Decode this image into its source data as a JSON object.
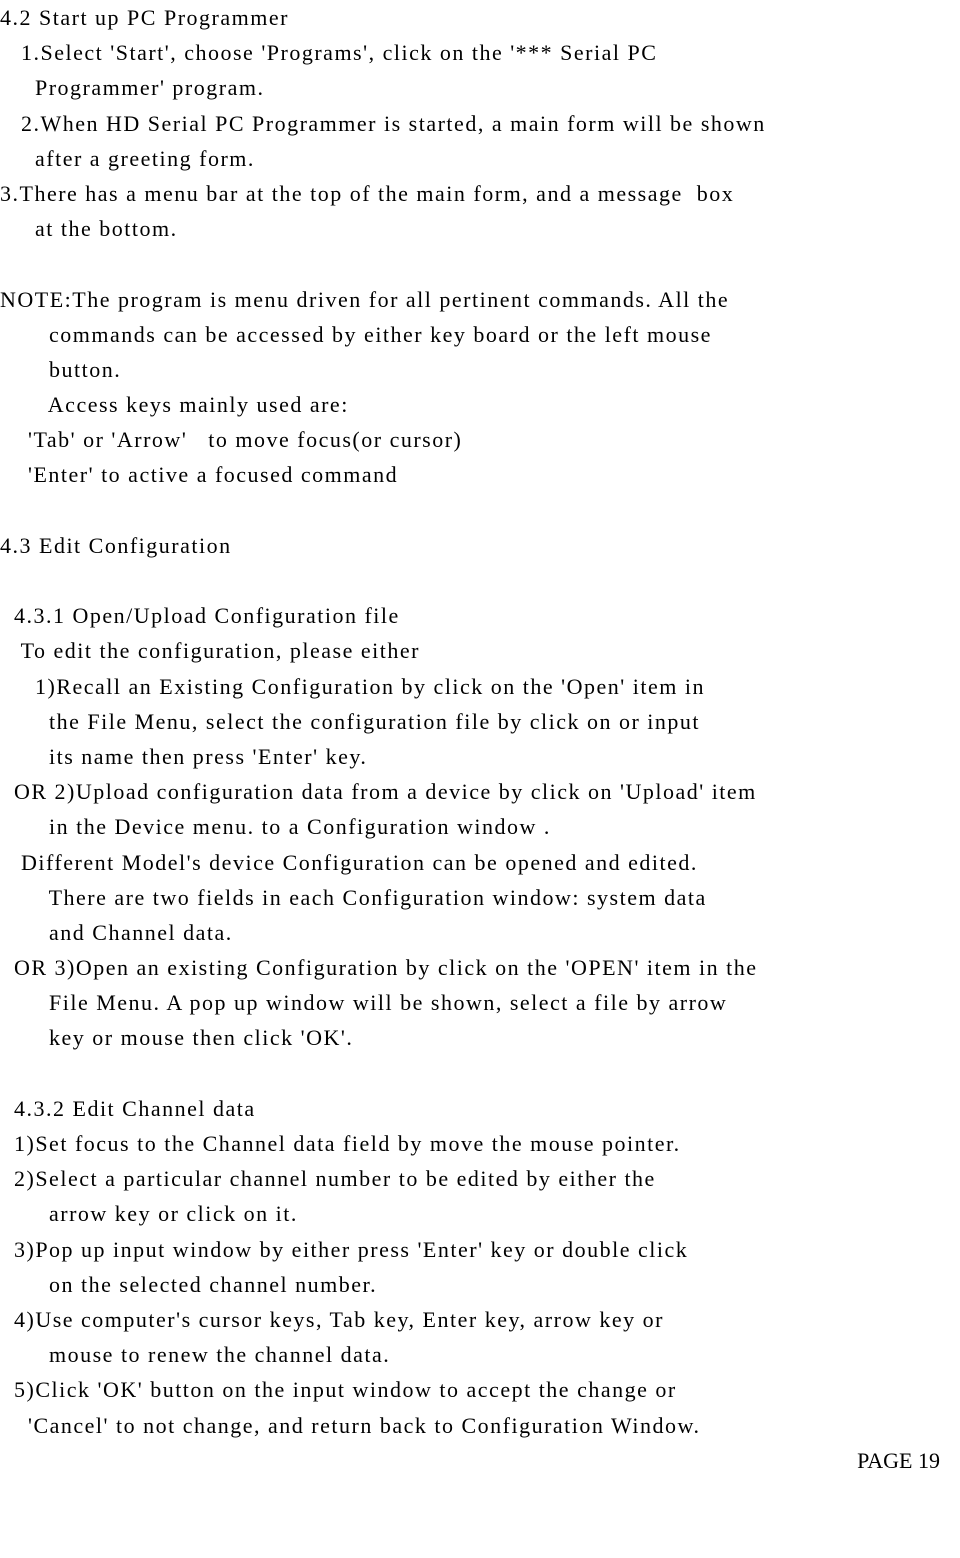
{
  "lines": [
    "4.2 Start up PC Programmer",
    "   1.Select 'Start', choose 'Programs', click on the '*** Serial PC",
    "     Programmer' program.",
    "   2.When HD Serial PC Programmer is started, a main form will be shown",
    "     after a greeting form.",
    "3.There has a menu bar at the top of the main form, and a message  box",
    "     at the bottom.",
    "",
    "NOTE:The program is menu driven for all pertinent commands. All the",
    "       commands can be accessed by either key board or the left mouse",
    "       button.",
    "       Access keys mainly used are:",
    "    'Tab' or 'Arrow'   to move focus(or cursor)",
    "    'Enter' to active a focused command",
    "",
    "4.3 Edit Configuration",
    "",
    "  4.3.1 Open/Upload Configuration file",
    "   To edit the configuration, please either",
    "     1)Recall an Existing Configuration by click on the 'Open' item in",
    "       the File Menu, select the configuration file by click on or input",
    "       its name then press 'Enter' key.",
    "  OR 2)Upload configuration data from a device by click on 'Upload' item",
    "       in the Device menu. to a Configuration window .",
    "   Different Model's device Configuration can be opened and edited.",
    "       There are two fields in each Configuration window: system data",
    "       and Channel data.",
    "  OR 3)Open an existing Configuration by click on the 'OPEN' item in the",
    "       File Menu. A pop up window will be shown, select a file by arrow",
    "       key or mouse then click 'OK'.",
    "",
    "  4.3.2 Edit Channel data",
    "  1)Set focus to the Channel data field by move the mouse pointer.",
    "  2)Select a particular channel number to be edited by either the",
    "       arrow key or click on it.",
    "  3)Pop up input window by either press 'Enter' key or double click",
    "       on the selected channel number.",
    "  4)Use computer's cursor keys, Tab key, Enter key, arrow key or",
    "       mouse to renew the channel data.",
    "  5)Click 'OK' button on the input window to accept the change or",
    "    'Cancel' to not change, and return back to Configuration Window."
  ],
  "page_label": "PAGE 19"
}
